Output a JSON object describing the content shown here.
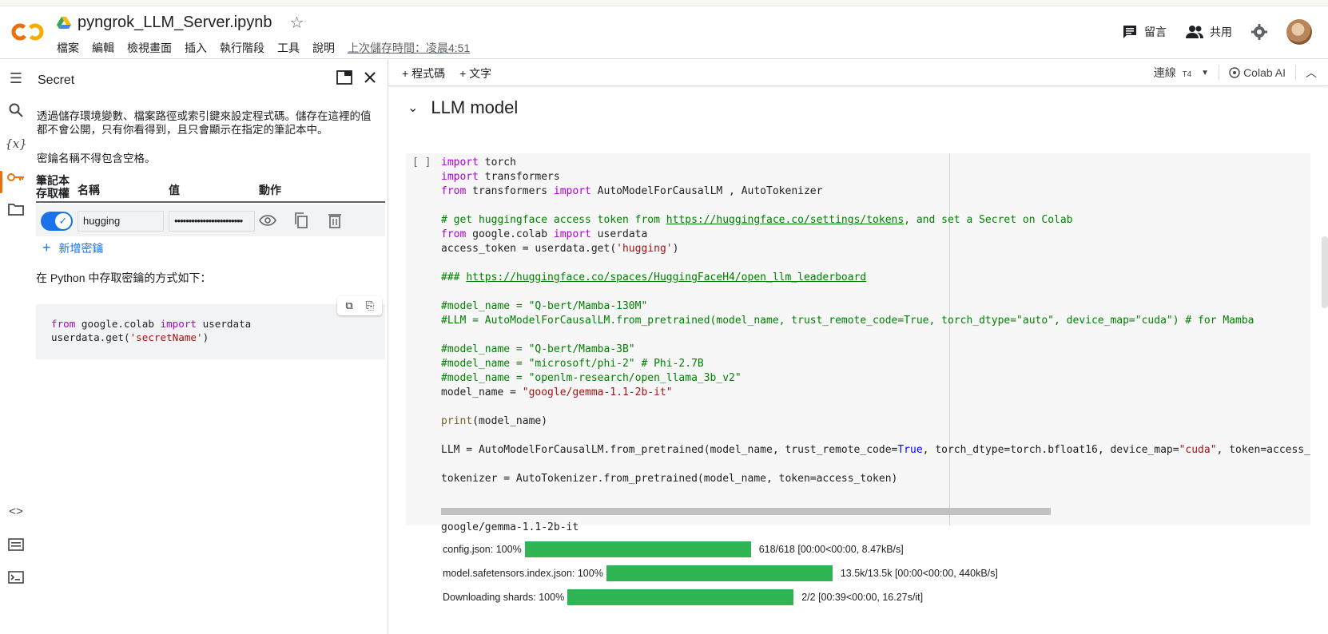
{
  "header": {
    "filename": "pyngrok_LLM_Server.ipynb",
    "menus": [
      "檔案",
      "編輯",
      "檢視畫面",
      "插入",
      "執行階段",
      "工具",
      "說明"
    ],
    "last_saved": "上次儲存時間：凌晨4:51",
    "comment_label": "留言",
    "share_label": "共用"
  },
  "secrets_panel": {
    "title": "Secret",
    "description": "透過儲存環境變數、檔案路徑或索引鍵來設定程式碼。儲存在這裡的值都不會公開，只有你看得到，且只會顯示在指定的筆記本中。",
    "note": "密鑰名稱不得包含空格。",
    "columns": {
      "access": "筆記本存取權",
      "name": "名稱",
      "value": "值",
      "action": "動作"
    },
    "secret": {
      "enabled": true,
      "name": "hugging",
      "value_masked": "••••••••••••••••••••••••"
    },
    "add_label": "新增密鑰",
    "python_note": "在 Python 中存取密鑰的方式如下："
  },
  "toolbar": {
    "add_code": "程式碼",
    "add_text": "文字",
    "connect": "連線",
    "runtime": "T4",
    "colab_ai": "Colab AI"
  },
  "section": {
    "title": "LLM model"
  },
  "cell": {
    "run_indicator": "[ ]"
  },
  "output": {
    "model_name": "google/gemma-1.1-2b-it",
    "progress": [
      {
        "label": "config.json:",
        "percent": 100,
        "percent_text": "100%",
        "info": "618/618  [00:00<00:00,  8.47kB/s]"
      },
      {
        "label": "model.safetensors.index.json:",
        "percent": 100,
        "percent_text": "100%",
        "info": "13.5k/13.5k  [00:00<00:00,  440kB/s]"
      },
      {
        "label": "Downloading shards:",
        "percent": 100,
        "percent_text": "100%",
        "info": "2/2  [00:39<00:00,  16.27s/it]"
      }
    ]
  },
  "colors": {
    "accent": "#1a73e8",
    "progress_fill": "#2fb554",
    "colab_orange": "#f9ab00"
  }
}
